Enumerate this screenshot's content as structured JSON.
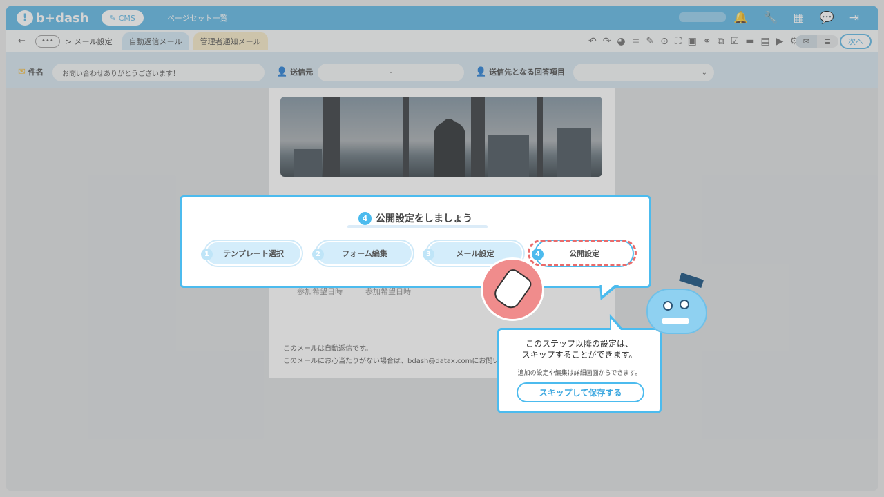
{
  "app": {
    "brand": "b+dash",
    "cms_label": "CMS",
    "nav_link": "ページセット一覧",
    "logo_mark": "!"
  },
  "toolbar": {
    "back": "←",
    "more": "•••",
    "crumb": "> メール設定",
    "tab_active": "自動返信メール",
    "tab_other": "管理者通知メール",
    "next": "次へ"
  },
  "header": {
    "subject_label": "件名",
    "subject_value": "お問い合わせありがとうございます！",
    "sender_label": "送信元",
    "sender_value": "-",
    "recipient_label": "送信先となる回答項目"
  },
  "mail": {
    "faint_text": "参加希望日時　　　参加希望日時",
    "footer_line1": "このメールは自動返信です。",
    "footer_line2": "このメールにお心当たりがない場合は、bdash@datax.comにお問い合わ"
  },
  "stepper": {
    "title_num": "4",
    "title": "公開設定をしましょう",
    "steps": [
      {
        "num": "1",
        "label": "テンプレート選択"
      },
      {
        "num": "2",
        "label": "フォーム編集"
      },
      {
        "num": "3",
        "label": "メール設定"
      },
      {
        "num": "4",
        "label": "公開設定"
      }
    ]
  },
  "tip": {
    "line1": "このステップ以降の設定は、",
    "line2": "スキップすることができます。",
    "sub": "追加の設定や編集は詳細画面からできます。",
    "button": "スキップして保存する"
  },
  "colors": {
    "accent": "#4cbbee",
    "highlight": "#e96b6b",
    "brand": "#56b3e3"
  },
  "icons": [
    "bell-icon",
    "wrench-icon",
    "grid-icon",
    "chat-icon",
    "logout-icon"
  ]
}
